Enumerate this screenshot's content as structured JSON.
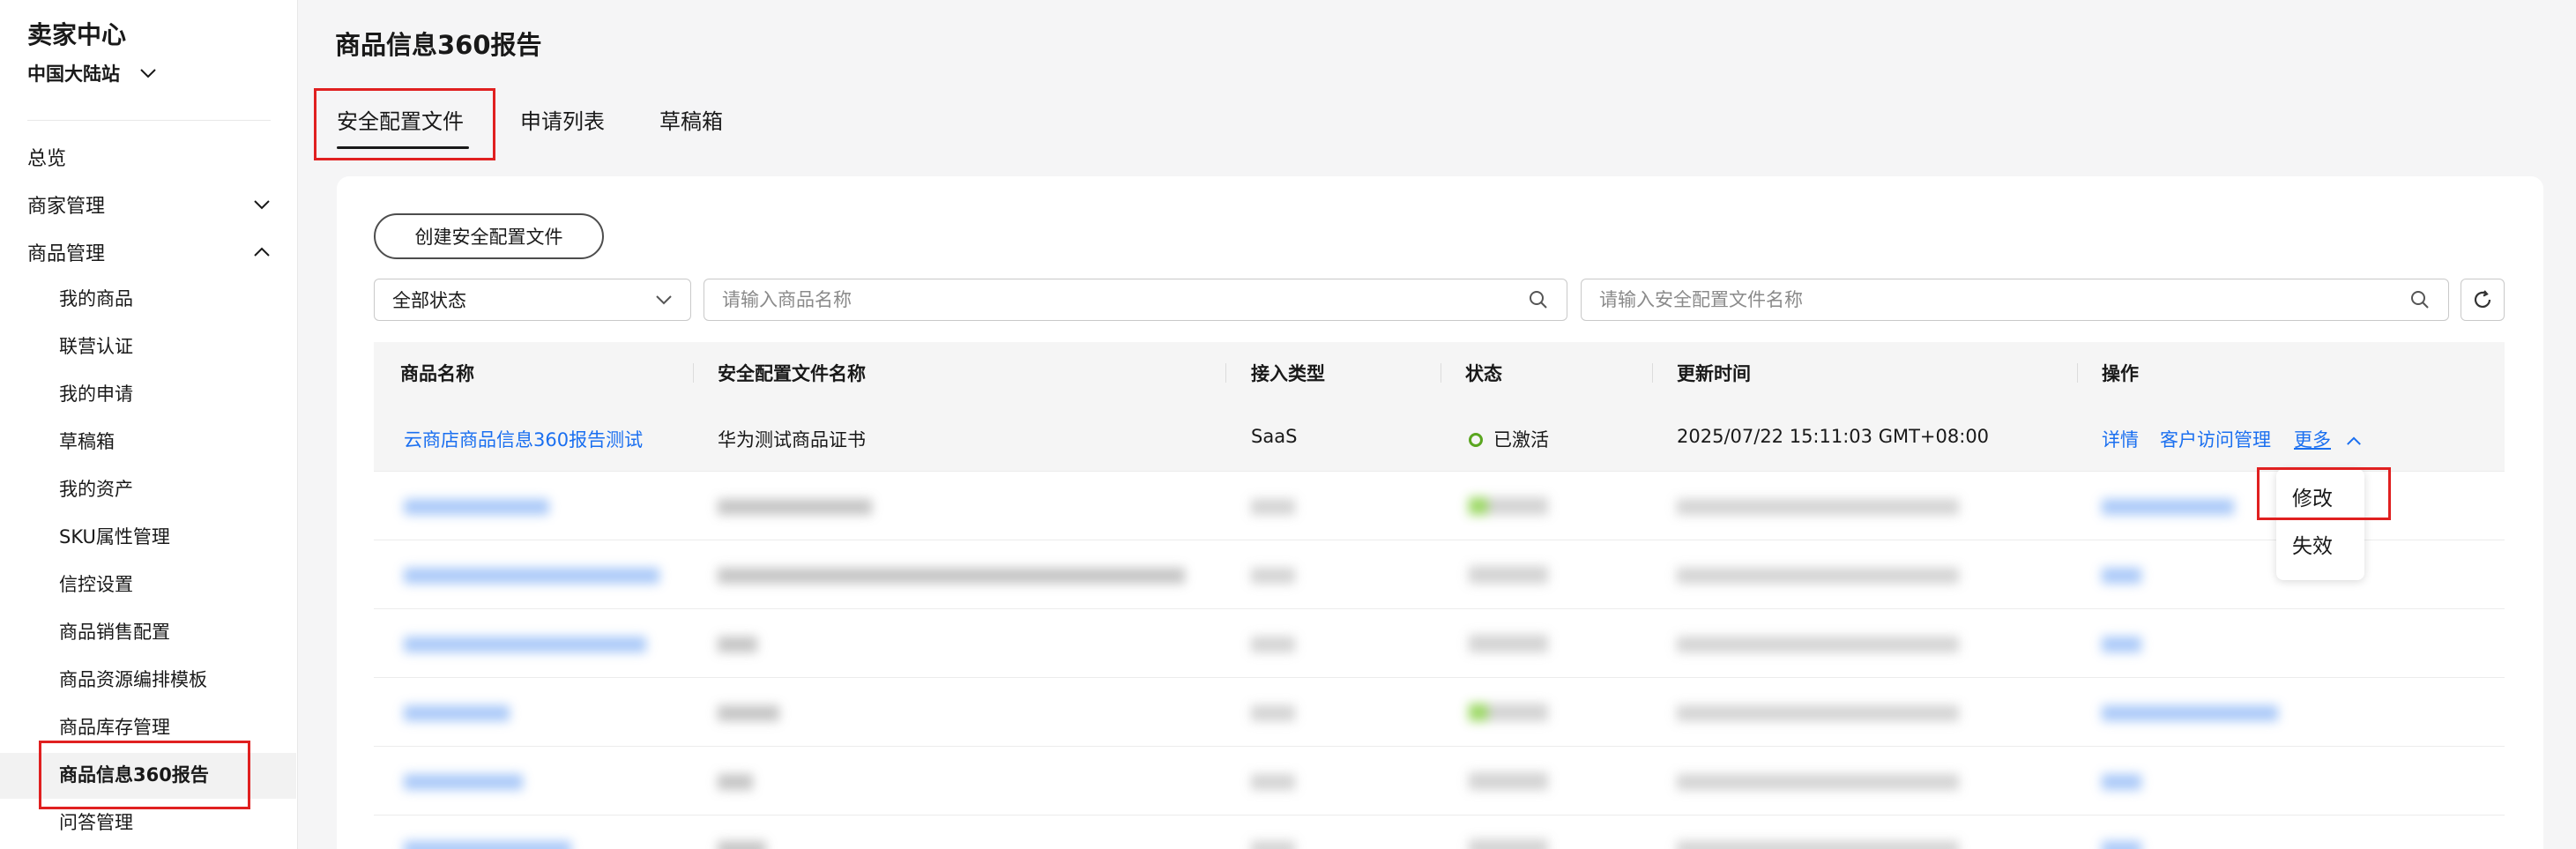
{
  "sidebar": {
    "title": "卖家中心",
    "site": "中国大陆站",
    "items": [
      {
        "label": "总览"
      },
      {
        "label": "商家管理"
      },
      {
        "label": "商品管理"
      }
    ],
    "sub_items": [
      {
        "label": "我的商品"
      },
      {
        "label": "联营认证"
      },
      {
        "label": "我的申请"
      },
      {
        "label": "草稿箱"
      },
      {
        "label": "我的资产"
      },
      {
        "label": "SKU属性管理"
      },
      {
        "label": "信控设置"
      },
      {
        "label": "商品销售配置"
      },
      {
        "label": "商品资源编排模板"
      },
      {
        "label": "商品库存管理"
      },
      {
        "label": "商品信息360报告",
        "active": true
      },
      {
        "label": "问答管理"
      }
    ]
  },
  "page": {
    "title": "商品信息360报告",
    "tabs": [
      {
        "label": "安全配置文件",
        "active": true
      },
      {
        "label": "申请列表"
      },
      {
        "label": "草稿箱"
      }
    ]
  },
  "toolbar": {
    "create_label": "创建安全配置文件",
    "status_select": "全部状态",
    "product_search_placeholder": "请输入商品名称",
    "profile_search_placeholder": "请输入安全配置文件名称"
  },
  "table": {
    "columns": [
      "商品名称",
      "安全配置文件名称",
      "接入类型",
      "状态",
      "更新时间",
      "操作"
    ],
    "first_row": {
      "product": "云商店商品信息360报告测试",
      "profile": "华为测试商品证书",
      "type": "SaaS",
      "status": "已激活",
      "updated": "2025/07/22 15:11:03 GMT+08:00",
      "actions": [
        "详情",
        "客户访问管理",
        "更多"
      ]
    }
  },
  "more_menu": {
    "items": [
      "修改",
      "失效"
    ]
  },
  "colors": {
    "link": "#1a6ff0",
    "highlight_box": "#e02020",
    "status_active": "#5aa61f"
  }
}
